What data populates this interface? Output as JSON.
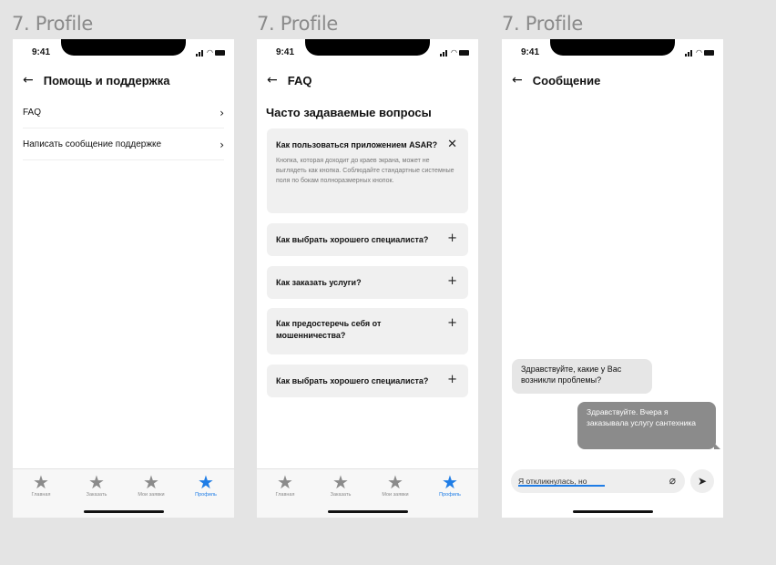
{
  "screens": [
    {
      "section_label": "7. Profile",
      "status_time": "9:41",
      "nav_title": "Помощь и поддержка",
      "menu": [
        {
          "label": "FAQ"
        },
        {
          "label": "Написать сообщение поддержке"
        }
      ]
    },
    {
      "section_label": "7. Profile",
      "status_time": "9:41",
      "nav_title": "FAQ",
      "heading": "Часто задаваемые вопросы",
      "faq": [
        {
          "question": "Как пользоваться приложением ASAR?",
          "answer": "Кнопка, которая доходит до краев экрана, может не выглядеть как кнопка. Соблюдайте стандартные системные поля по бокам полноразмерных кнопок.",
          "expanded": true
        },
        {
          "question": "Как выбрать хорошего специалиста?",
          "expanded": false
        },
        {
          "question": "Как заказать услуги?",
          "expanded": false
        },
        {
          "question": "Как предостеречь себя от мошенничества?",
          "expanded": false
        },
        {
          "question": "Как выбрать хорошего специалиста?",
          "expanded": false
        }
      ]
    },
    {
      "section_label": "7. Profile",
      "status_time": "9:41",
      "nav_title": "Сообщение",
      "messages": [
        {
          "from": "support",
          "text": "Здравствуйте, какие у Вас возникли проблемы?"
        },
        {
          "from": "user",
          "text": "Здравствуйте. Вчера я заказывала услугу сантехника"
        }
      ],
      "input_value": "Я откликнулась, но"
    }
  ],
  "tabbar": {
    "items": [
      "Главная",
      "Заказать",
      "Мои заявки",
      "Профиль"
    ],
    "active_index": 3
  },
  "colors": {
    "accent": "#1f7de6",
    "inactive_icon": "#8b8b8b",
    "bubble_user": "#8b8b8b",
    "bubble_support": "#e6e6e6"
  },
  "icons": {
    "back": "arrow-left-icon",
    "chevron": "chevron-right-icon",
    "close": "close-icon",
    "plus": "plus-icon",
    "tab": "star-icon",
    "attach": "paperclip-icon",
    "send": "send-icon"
  }
}
